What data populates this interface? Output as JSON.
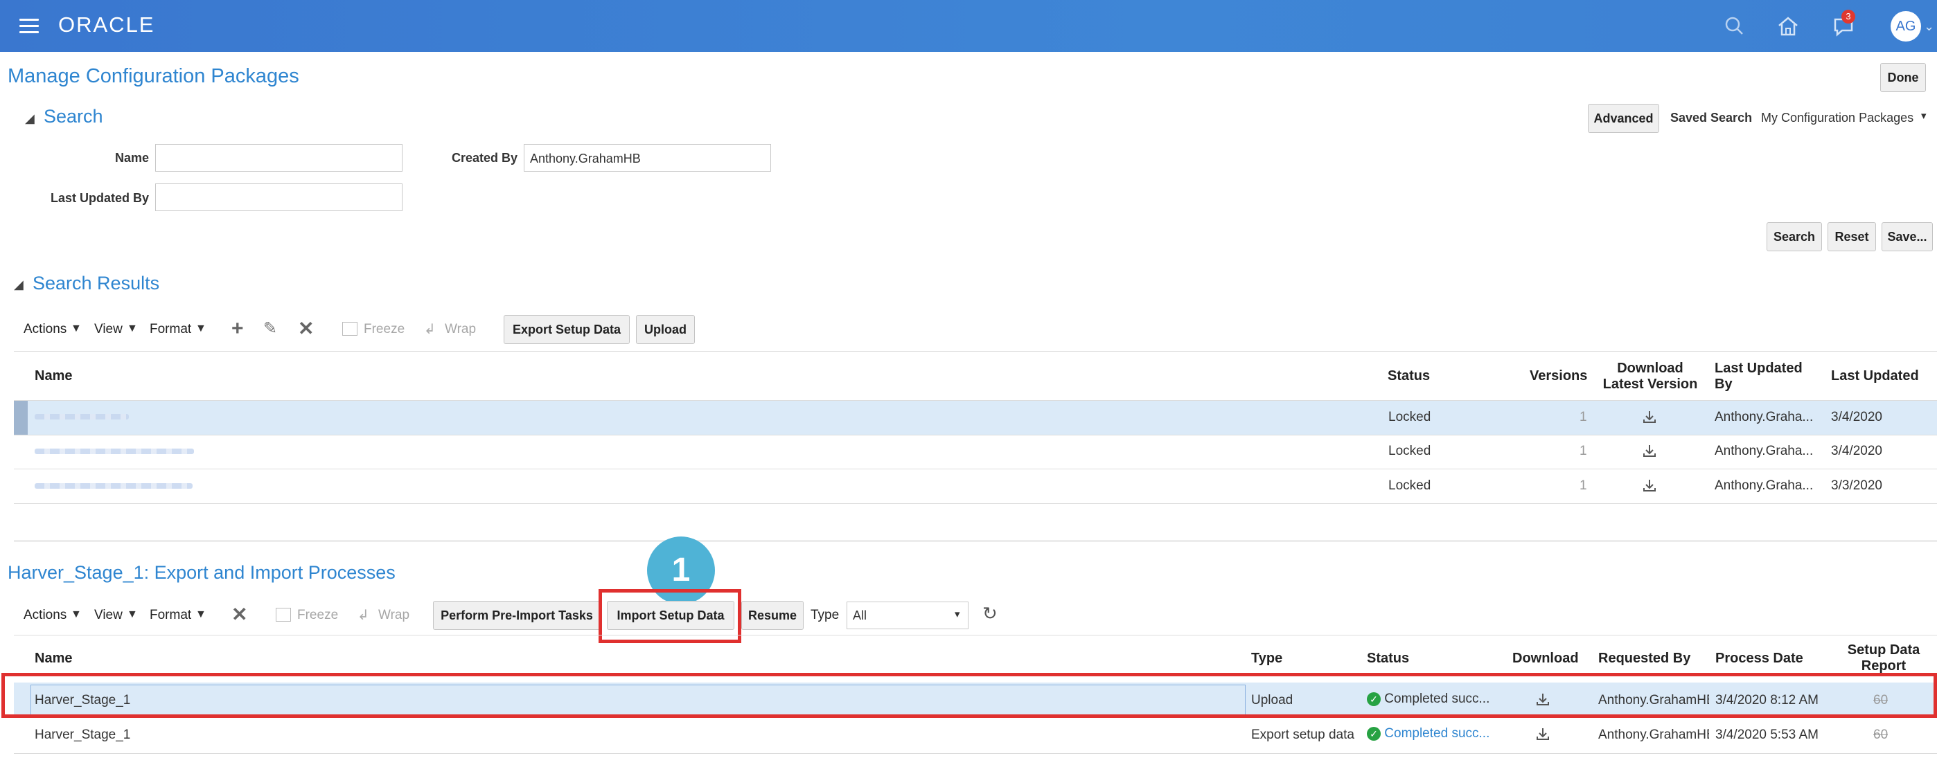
{
  "app": {
    "logo": "ORACLE",
    "avatar": "AG",
    "notifications": "3"
  },
  "icons": {
    "menu": "hamburger-icon",
    "search": "search-icon",
    "home": "home-icon",
    "notify": "bell-icon"
  },
  "page": {
    "title": "Manage Configuration Packages",
    "done": "Done"
  },
  "search": {
    "heading": "Search",
    "advanced": "Advanced",
    "saved_search_label": "Saved Search",
    "saved_search_value": "My Configuration Packages",
    "name_label": "Name",
    "name_value": "",
    "created_by_label": "Created By",
    "created_by_value": "Anthony.GrahamHB",
    "last_updated_by_label": "Last Updated By",
    "last_updated_by_value": "",
    "search_btn": "Search",
    "reset_btn": "Reset",
    "save_btn": "Save..."
  },
  "results": {
    "heading": "Search Results",
    "toolbar": {
      "actions": "Actions",
      "view": "View",
      "format": "Format",
      "freeze": "Freeze",
      "wrap": "Wrap",
      "export": "Export Setup Data",
      "upload": "Upload"
    },
    "columns": {
      "name": "Name",
      "status": "Status",
      "versions": "Versions",
      "download_1": "Download",
      "download_2": "Latest Version",
      "updated_by_1": "Last Updated",
      "updated_by_2": "By",
      "last_updated": "Last Updated"
    },
    "rows": [
      {
        "status": "Locked",
        "versions": "1",
        "updated_by": "Anthony.Graha...",
        "updated": "3/4/2020"
      },
      {
        "status": "Locked",
        "versions": "1",
        "updated_by": "Anthony.Graha...",
        "updated": "3/4/2020"
      },
      {
        "status": "Locked",
        "versions": "1",
        "updated_by": "Anthony.Graha...",
        "updated": "3/3/2020"
      }
    ]
  },
  "processes": {
    "heading": "Harver_Stage_1: Export and Import Processes",
    "callout": "1",
    "toolbar": {
      "actions": "Actions",
      "view": "View",
      "format": "Format",
      "freeze": "Freeze",
      "wrap": "Wrap",
      "pre_import": "Perform Pre-Import Tasks",
      "import": "Import Setup Data",
      "resume": "Resume",
      "type_label": "Type",
      "type_value": "All"
    },
    "columns": {
      "name": "Name",
      "type": "Type",
      "status": "Status",
      "download": "Download",
      "requested_by": "Requested By",
      "process_date": "Process Date",
      "report_1": "Setup Data",
      "report_2": "Report"
    },
    "rows": [
      {
        "name": "Harver_Stage_1",
        "type": "Upload",
        "status": "Completed succ...",
        "requested_by": "Anthony.GrahamHB",
        "process_date": "3/4/2020 8:12 AM",
        "report": "60"
      },
      {
        "name": "Harver_Stage_1",
        "type": "Export setup data",
        "status": "Completed succ...",
        "requested_by": "Anthony.GrahamHB",
        "process_date": "3/4/2020 5:53 AM",
        "report": "60"
      }
    ]
  },
  "colors": {
    "header": "#3a77cf",
    "link": "#2e85d0",
    "highlight": "#e0302f",
    "callout": "#4fb3d6",
    "selected_row": "#dbeaf8"
  }
}
